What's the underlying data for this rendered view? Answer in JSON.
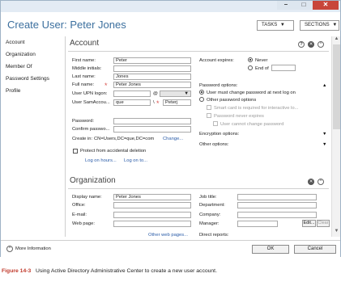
{
  "window": {
    "minimize": "–",
    "maximize": "□",
    "close": "✕"
  },
  "title": {
    "prefix": "Create User:",
    "name": "Peter Jones"
  },
  "menus": {
    "tasks": "TASKS",
    "sections": "SECTIONS",
    "arrow": "▼"
  },
  "nav": [
    "Account",
    "Organization",
    "Member Of",
    "Password Settings",
    "Profile"
  ],
  "account": {
    "header": "Account",
    "first_name": {
      "label": "First name:",
      "value": "Peter"
    },
    "middle_initials": {
      "label": "Middle initials:",
      "value": ""
    },
    "last_name": {
      "label": "Last name:",
      "value": "Jones"
    },
    "full_name": {
      "label": "Full name:",
      "value": "Peter Jones"
    },
    "upn": {
      "label": "User UPN logon:",
      "value": "",
      "at": "@",
      "domain": ""
    },
    "sam": {
      "label": "User SamAccou...",
      "domain": "que",
      "separator": "\\",
      "value": "Peterj"
    },
    "password": {
      "label": "Password:",
      "value": ""
    },
    "confirm": {
      "label": "Confirm passwo...",
      "value": ""
    },
    "create_in": {
      "label": "Create in:",
      "value": "CN=Users,DC=que,DC=com",
      "change": "Change..."
    },
    "protect": {
      "label": "Protect from accidental deletion",
      "checked": false
    },
    "log_on_hours": "Log on hours...",
    "log_on_to": "Log on to...",
    "expires": {
      "label": "Account expires:",
      "never": "Never",
      "end_of": "End of",
      "selected": "Never"
    },
    "password_options": {
      "label": "Password options:",
      "must_change": "User must change password at next log on",
      "other": "Other password options",
      "selected": "must_change",
      "smart_card": "Smart card is required for interactive lo...",
      "never_expires": "Password never expires",
      "cannot_change": "User cannot change password"
    },
    "encryption": "Encryption options:",
    "other_options": "Other options:"
  },
  "organization": {
    "header": "Organization",
    "display_name": {
      "label": "Display name:",
      "value": "Peter Jones"
    },
    "office": {
      "label": "Office:",
      "value": ""
    },
    "email": {
      "label": "E-mail:",
      "value": ""
    },
    "web_page": {
      "label": "Web page:",
      "value": ""
    },
    "other_web_pages": "Other web pages...",
    "job_title": {
      "label": "Job title:",
      "value": ""
    },
    "department": {
      "label": "Department:",
      "value": ""
    },
    "company": {
      "label": "Company:",
      "value": ""
    },
    "manager": {
      "label": "Manager:",
      "value": "",
      "edit": "Edit...",
      "clear": "Clear"
    },
    "direct_reports": "Direct reports:"
  },
  "footer": {
    "more_info": "More Information",
    "ok": "OK",
    "cancel": "Cancel"
  },
  "caption": {
    "number": "Figure 14-3",
    "text": "Using Active Directory Administrative Center to create a new user account."
  },
  "colors": {
    "title": "#3b6f9e",
    "required": "#d9534f",
    "link": "#2a5ca8",
    "close": "#c8453a"
  }
}
